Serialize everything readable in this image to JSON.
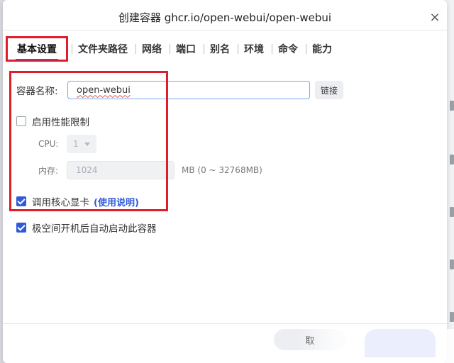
{
  "dialog": {
    "title": "创建容器 ghcr.io/open-webui/open-webui",
    "close_glyph": "×"
  },
  "tabs": [
    {
      "label": "基本设置",
      "active": true
    },
    {
      "label": "文件夹路径"
    },
    {
      "label": "网络"
    },
    {
      "label": "端口"
    },
    {
      "label": "别名"
    },
    {
      "label": "环境"
    },
    {
      "label": "命令"
    },
    {
      "label": "能力"
    }
  ],
  "form": {
    "container_name_label": "容器名称:",
    "container_name_value": "open-webui",
    "link_button": "链接",
    "perf_limit_label": "启用性能限制",
    "perf_limit_checked": false,
    "cpu_label": "CPU:",
    "cpu_value": "1",
    "memory_label": "内存:",
    "memory_value": "1024",
    "memory_hint": "MB (0 ~ 32768MB)",
    "gpu_label": "调用核心显卡",
    "gpu_checked": true,
    "gpu_help_link": "(使用说明)",
    "autostart_label": "极空间开机后自动启动此容器",
    "autostart_checked": true
  },
  "footer": {
    "cancel_label": "取"
  },
  "colors": {
    "accent": "#2f5bd9",
    "highlight_box": "#e01e2b",
    "primary_button": "#7b96f2"
  }
}
